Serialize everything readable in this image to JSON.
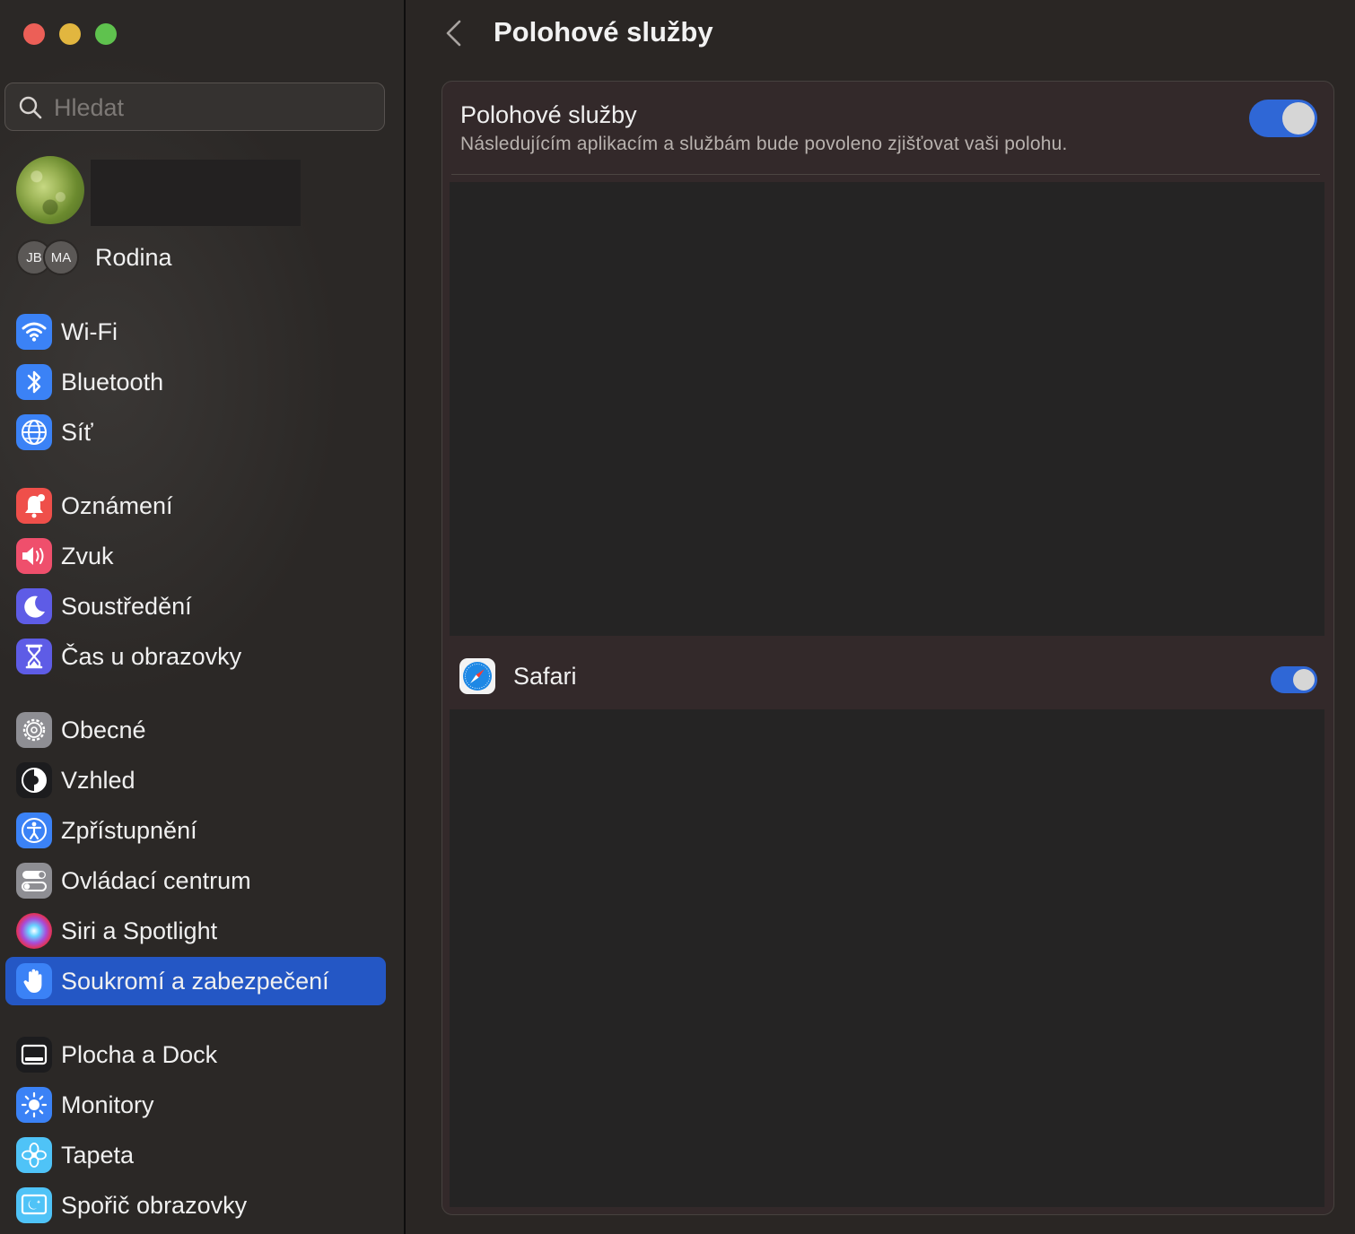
{
  "window": {
    "controls": [
      "close",
      "minimize",
      "zoom"
    ]
  },
  "sidebar": {
    "search_placeholder": "Hledat",
    "family_initials": [
      "JB",
      "MA"
    ],
    "family_label": "Rodina",
    "items": [
      {
        "label": "Wi-Fi",
        "icon": "wifi-icon",
        "color": "#3b82f6"
      },
      {
        "label": "Bluetooth",
        "icon": "bluetooth-icon",
        "color": "#3b82f6"
      },
      {
        "label": "Síť",
        "icon": "globe-icon",
        "color": "#3b82f6"
      },
      {
        "label": "Oznámení",
        "icon": "bell-icon",
        "color": "#ef4f4a"
      },
      {
        "label": "Zvuk",
        "icon": "speaker-icon",
        "color": "#ef4f6c"
      },
      {
        "label": "Soustředění",
        "icon": "moon-icon",
        "color": "#5e5ce6"
      },
      {
        "label": "Čas u obrazovky",
        "icon": "hourglass-icon",
        "color": "#5e5ce6"
      },
      {
        "label": "Obecné",
        "icon": "gear-icon",
        "color": "#8e8e93"
      },
      {
        "label": "Vzhled",
        "icon": "appearance-icon",
        "color": "#1c1c1e"
      },
      {
        "label": "Zpřístupnění",
        "icon": "accessibility-icon",
        "color": "#3b82f6"
      },
      {
        "label": "Ovládací centrum",
        "icon": "control-center-icon",
        "color": "#8e8e93"
      },
      {
        "label": "Siri a Spotlight",
        "icon": "siri-icon",
        "color": "#6b3fa0"
      },
      {
        "label": "Soukromí a zabezpečení",
        "icon": "hand-icon",
        "color": "#3b82f6",
        "active": true
      },
      {
        "label": "Plocha a Dock",
        "icon": "dock-icon",
        "color": "#1c1c1e"
      },
      {
        "label": "Monitory",
        "icon": "sun-icon",
        "color": "#3b82f6"
      },
      {
        "label": "Tapeta",
        "icon": "flower-icon",
        "color": "#4fc3f7"
      },
      {
        "label": "Spořič obrazovky",
        "icon": "screensaver-icon",
        "color": "#4fc3f7"
      }
    ]
  },
  "main": {
    "title": "Polohové služby",
    "location_services": {
      "title": "Polohové služby",
      "description": "Následujícím aplikacím a službám bude povoleno zjišťovat vaši polohu.",
      "enabled": true
    },
    "apps": [
      {
        "name": "Safari",
        "icon": "safari-icon",
        "enabled": true
      }
    ],
    "accent_color": "#2f67d6"
  }
}
